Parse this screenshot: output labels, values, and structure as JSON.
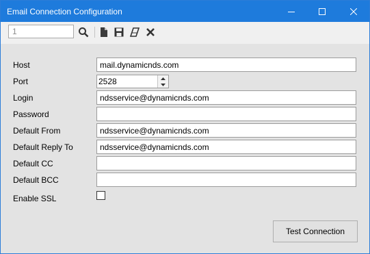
{
  "window": {
    "title": "Email Connection Configuration",
    "controls": [
      "minimize-icon",
      "maximize-icon",
      "close-icon"
    ]
  },
  "toolbar": {
    "record_number": "1",
    "icons": [
      "search-icon",
      "new-document-icon",
      "save-icon",
      "eraser-icon",
      "delete-icon"
    ]
  },
  "form": {
    "host": {
      "label": "Host",
      "value": "mail.dynamicnds.com"
    },
    "port": {
      "label": "Port",
      "value": "2528"
    },
    "login": {
      "label": "Login",
      "value": "ndsservice@dynamicnds.com"
    },
    "password": {
      "label": "Password",
      "value": ""
    },
    "default_from": {
      "label": "Default From",
      "value": "ndsservice@dynamicnds.com"
    },
    "default_reply_to": {
      "label": "Default Reply To",
      "value": "ndsservice@dynamicnds.com"
    },
    "default_cc": {
      "label": "Default CC",
      "value": ""
    },
    "default_bcc": {
      "label": "Default BCC",
      "value": ""
    },
    "enable_ssl": {
      "label": "Enable SSL",
      "checked": false
    }
  },
  "actions": {
    "test_connection_label": "Test Connection"
  },
  "colors": {
    "titlebar": "#1e7bdc",
    "content_background": "#e3e3e3"
  }
}
